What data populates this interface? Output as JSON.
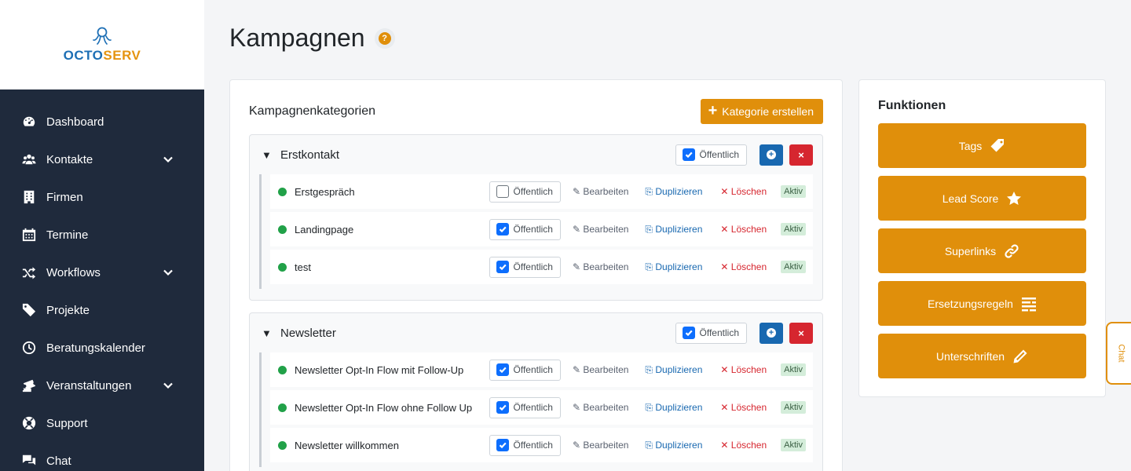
{
  "brand": {
    "name_part1": "OCTO",
    "name_part2": "SERV",
    "primary": "#1d6fb5",
    "accent": "#e59411"
  },
  "sidebar": {
    "items": [
      {
        "label": "Dashboard",
        "icon": "dashboard-icon",
        "has_submenu": false
      },
      {
        "label": "Kontakte",
        "icon": "users-icon",
        "has_submenu": true
      },
      {
        "label": "Firmen",
        "icon": "building-icon",
        "has_submenu": false
      },
      {
        "label": "Termine",
        "icon": "calendar-icon",
        "has_submenu": false
      },
      {
        "label": "Workflows",
        "icon": "shuffle-icon",
        "has_submenu": true
      },
      {
        "label": "Projekte",
        "icon": "folder-icon",
        "has_submenu": false
      },
      {
        "label": "Beratungskalender",
        "icon": "clock-icon",
        "has_submenu": false
      },
      {
        "label": "Veranstaltungen",
        "icon": "tickets-icon",
        "has_submenu": true
      },
      {
        "label": "Support",
        "icon": "lifebuoy-icon",
        "has_submenu": false
      },
      {
        "label": "Chat",
        "icon": "chat-icon",
        "has_submenu": false
      }
    ]
  },
  "page": {
    "title": "Kampagnen",
    "help_symbol": "?"
  },
  "campaigns": {
    "title": "Kampagnenkategorien",
    "create_button": "Kategorie erstellen",
    "categories": [
      {
        "name": "Erstkontakt",
        "public_label": "Öffentlich",
        "public": true,
        "items": [
          {
            "name": "Erstgespräch",
            "public": false,
            "public_label": "Öffentlich",
            "edit": "✎ Bearbeiten",
            "duplicate": "⎘ Duplizieren",
            "delete": "✕ Löschen",
            "status": "Aktiv"
          },
          {
            "name": "Landingpage",
            "public": true,
            "public_label": "Öffentlich",
            "edit": "✎ Bearbeiten",
            "duplicate": "⎘ Duplizieren",
            "delete": "✕ Löschen",
            "status": "Aktiv"
          },
          {
            "name": "test",
            "public": true,
            "public_label": "Öffentlich",
            "edit": "✎ Bearbeiten",
            "duplicate": "⎘ Duplizieren",
            "delete": "✕ Löschen",
            "status": "Aktiv"
          }
        ]
      },
      {
        "name": "Newsletter",
        "public_label": "Öffentlich",
        "public": true,
        "items": [
          {
            "name": "Newsletter Opt-In Flow mit Follow-Up",
            "public": true,
            "public_label": "Öffentlich",
            "edit": "✎ Bearbeiten",
            "duplicate": "⎘ Duplizieren",
            "delete": "✕ Löschen",
            "status": "Aktiv"
          },
          {
            "name": "Newsletter Opt-In Flow ohne Follow Up",
            "public": true,
            "public_label": "Öffentlich",
            "edit": "✎ Bearbeiten",
            "duplicate": "⎘ Duplizieren",
            "delete": "✕ Löschen",
            "status": "Aktiv"
          },
          {
            "name": "Newsletter willkommen",
            "public": true,
            "public_label": "Öffentlich",
            "edit": "✎ Bearbeiten",
            "duplicate": "⎘ Duplizieren",
            "delete": "✕ Löschen",
            "status": "Aktiv"
          }
        ]
      }
    ]
  },
  "functions": {
    "title": "Funktionen",
    "buttons": [
      {
        "label": "Tags",
        "icon": "tag-icon"
      },
      {
        "label": "Lead Score",
        "icon": "star-icon"
      },
      {
        "label": "Superlinks",
        "icon": "link-icon"
      },
      {
        "label": "Ersetzungsregeln",
        "icon": "text-align-icon"
      },
      {
        "label": "Unterschriften",
        "icon": "pencil-icon"
      }
    ]
  },
  "chat_tab": {
    "label": "Chat"
  },
  "colors": {
    "sidebar_bg": "#1f2a3c",
    "orange": "#e08f0b",
    "blue": "#1868b0",
    "red": "#d6262f",
    "green_dot": "#21a148"
  }
}
